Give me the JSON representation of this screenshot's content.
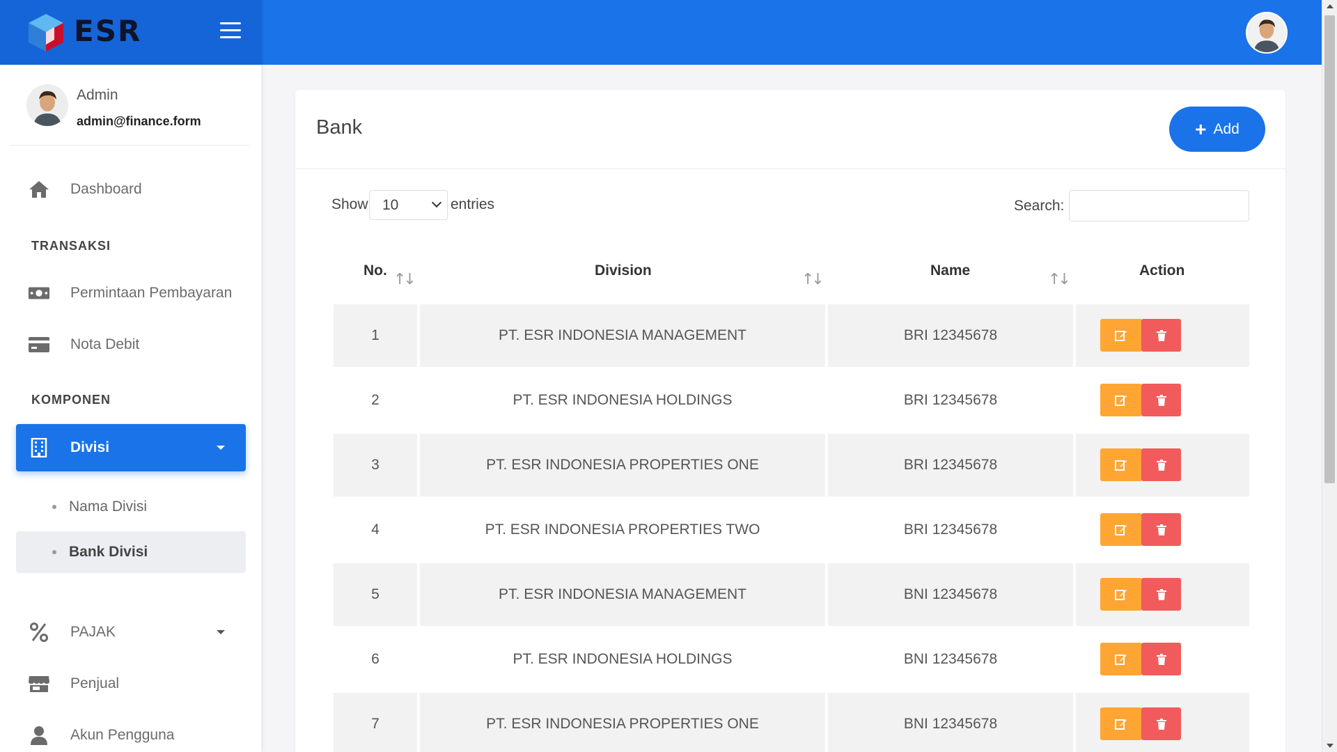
{
  "brand": {
    "name": "ESR"
  },
  "user": {
    "name": "Admin",
    "email": "admin@finance.form"
  },
  "sidebar": {
    "dashboard": "Dashboard",
    "section_transaksi": "TRANSAKSI",
    "permintaan": "Permintaan Pembayaran",
    "nota_debit": "Nota Debit",
    "section_komponen": "KOMPONEN",
    "divisi": "Divisi",
    "nama_divisi": "Nama Divisi",
    "bank_divisi": "Bank Divisi",
    "pajak": "PAJAK",
    "penjual": "Penjual",
    "akun_pengguna": "Akun Pengguna"
  },
  "page": {
    "title": "Bank",
    "add_label": "Add"
  },
  "table_controls": {
    "show_label": "Show",
    "entries_value": "10",
    "entries_label": "entries",
    "search_label": "Search:",
    "search_value": ""
  },
  "table": {
    "headers": {
      "no": "No.",
      "division": "Division",
      "name": "Name",
      "action": "Action"
    },
    "rows": [
      {
        "no": "1",
        "division": "PT. ESR INDONESIA MANAGEMENT",
        "name": "BRI 12345678"
      },
      {
        "no": "2",
        "division": "PT. ESR INDONESIA HOLDINGS",
        "name": "BRI 12345678"
      },
      {
        "no": "3",
        "division": "PT. ESR INDONESIA PROPERTIES ONE",
        "name": "BRI 12345678"
      },
      {
        "no": "4",
        "division": "PT. ESR INDONESIA PROPERTIES TWO",
        "name": "BRI 12345678"
      },
      {
        "no": "5",
        "division": "PT. ESR INDONESIA MANAGEMENT",
        "name": "BNI 12345678"
      },
      {
        "no": "6",
        "division": "PT. ESR INDONESIA HOLDINGS",
        "name": "BNI 12345678"
      },
      {
        "no": "7",
        "division": "PT. ESR INDONESIA PROPERTIES ONE",
        "name": "BNI 12345678"
      }
    ]
  },
  "colors": {
    "primary": "#1a73e8",
    "edit": "#ffa534",
    "delete": "#f25b5b"
  },
  "icons": {
    "dashboard": "home-icon",
    "permintaan": "money-icon",
    "nota_debit": "credit-card-icon",
    "divisi": "building-icon",
    "pajak": "percent-icon",
    "penjual": "store-icon",
    "akun_pengguna": "user-icon",
    "edit": "edit-icon",
    "delete": "trash-icon"
  }
}
